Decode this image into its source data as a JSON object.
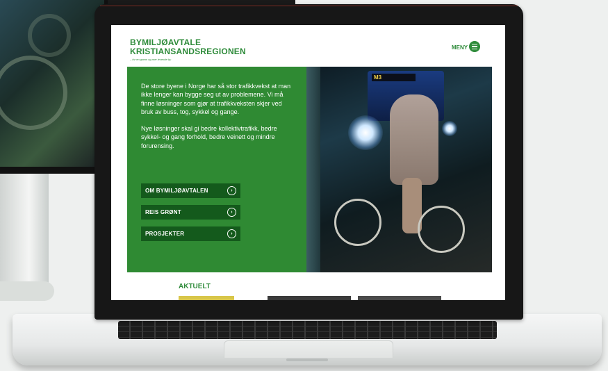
{
  "site": {
    "logo_line1": "BYMILJØAVTALE",
    "logo_line2": "KRISTIANSANDSREGIONEN",
    "logo_tagline": "– for en grønn og mer levende by"
  },
  "menu": {
    "label": "MENY"
  },
  "hero": {
    "paragraph1": "De store byene i Norge har så stor trafikkvekst at man ikke lenger kan bygge seg ut av problemene. Vi må finne løsninger som gjør at trafikkveksten skjer ved bruk av buss, tog, sykkel og gange.",
    "paragraph2": "Nye løsninger skal gi bedre kollektivtrafikk, bedre sykkel- og gang forhold, bedre veinett og mindre forurensing.",
    "buttons": [
      {
        "label": "OM BYMILJØAVTALEN"
      },
      {
        "label": "REIS GRØNT"
      },
      {
        "label": "PROSJEKTER"
      }
    ],
    "photo_bus_sign": "M3"
  },
  "section": {
    "aktuelt": "AKTUELT"
  },
  "colors": {
    "brand_green": "#2e8b3a",
    "hero_green": "#2f8a33",
    "button_dark_green": "#145a1c"
  }
}
